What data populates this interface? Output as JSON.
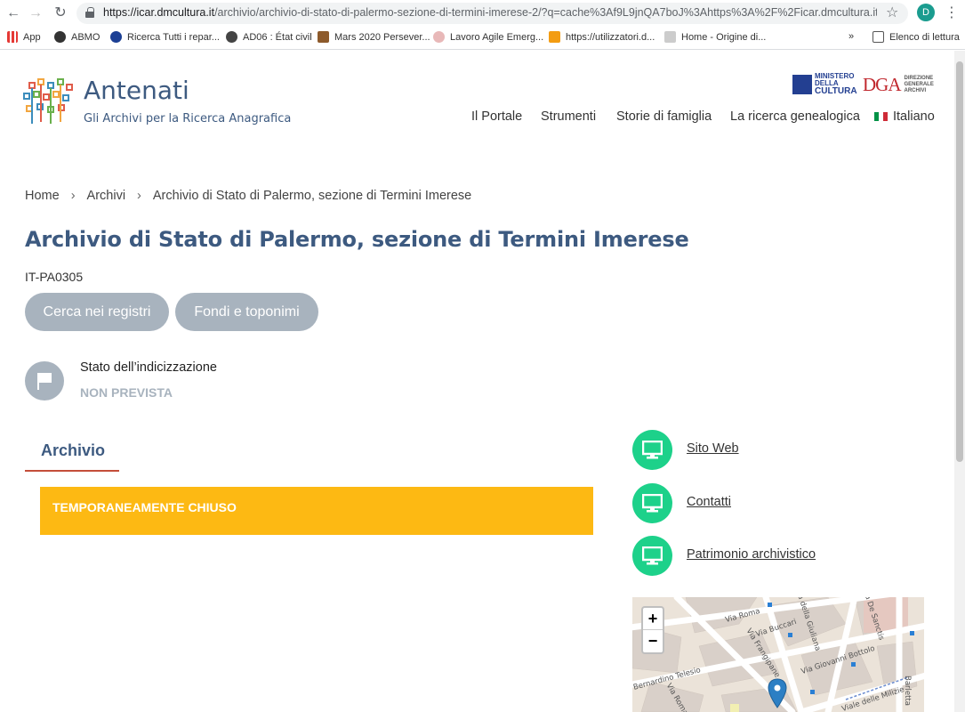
{
  "browser": {
    "url_host": "https://icar.dmcultura.it",
    "url_rest": "/archivio/archivio-di-stato-di-palermo-sezione-di-termini-imerese-2/?q=cache%3Af9L9jnQA7boJ%3Ahttps%3A%2F%2Ficar.dmcultura.it%2F...",
    "profile_initial": "D",
    "bookmarks": [
      "App",
      "ABMO",
      "Ricerca Tutti i repar...",
      "AD06 : État civil",
      "Mars 2020 Persever...",
      "Lavoro Agile Emerg...",
      "https://utilizzatori.d...",
      "Home - Origine di..."
    ],
    "more_bookmarks": "»",
    "reading_list": "Elenco di lettura"
  },
  "header": {
    "title": "Antenati",
    "subtitle": "Gli Archivi per la Ricerca Anagrafica",
    "ministero": [
      "MINISTERO",
      "DELLA",
      "CULTURA"
    ],
    "dga": "DGA",
    "dga_small": [
      "DIREZIONE",
      "GENERALE",
      "ARCHIVI"
    ],
    "nav": [
      "Il Portale",
      "Strumenti",
      "Storie di famiglia",
      "La ricerca genealogica",
      "Italiano"
    ]
  },
  "breadcrumb": [
    "Home",
    "Archivi",
    "Archivio di Stato di Palermo, sezione di Termini Imerese"
  ],
  "breadcrumb_sep": "›",
  "page": {
    "title": "Archivio di Stato di Palermo, sezione di Termini Imerese",
    "code": "IT-PA0305",
    "buttons": [
      "Cerca nei registri",
      "Fondi e toponimi"
    ],
    "status_label": "Stato dell’indicizzazione",
    "status_value": "NON PREVISTA",
    "tab": "Archivio",
    "notice": "TEMPORANEAMENTE CHIUSO"
  },
  "sidebar_links": [
    "Sito Web",
    "Contatti",
    "Patrimonio archivistico"
  ],
  "map": {
    "zoom_in": "+",
    "zoom_out": "−",
    "labels": [
      "Via Roma",
      "Via Buccari",
      "Via della Giuliana",
      "Via De Sanctis",
      "Via Giovanni Bottolo",
      "Via Frangipane",
      "Bernardino Telesio",
      "Via Roma",
      "Viale delle Milizie",
      "Barletta"
    ]
  },
  "colors": {
    "brand_blue": "#3d5a80",
    "pill_grey": "#a8b3be",
    "notice_yellow": "#fdb913",
    "link_green": "#1dd18a",
    "tab_underline": "#c44e3a"
  }
}
